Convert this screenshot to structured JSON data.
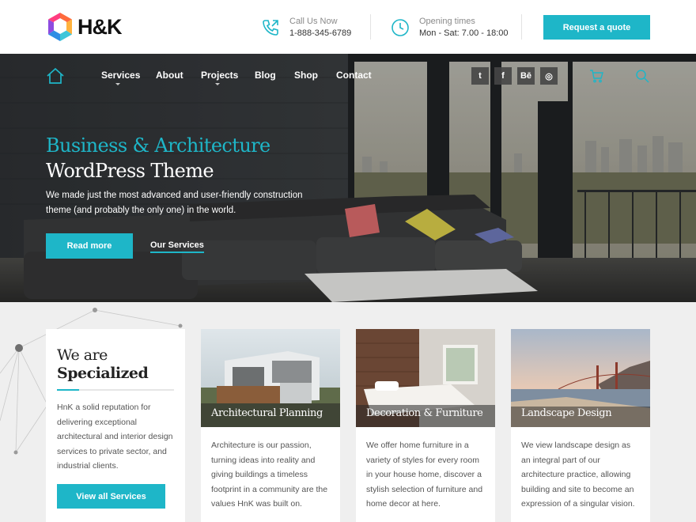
{
  "brand": {
    "logo_text": "H&K",
    "accent": "#1eb6c8"
  },
  "header": {
    "call_label": "Call Us Now",
    "call_value": "1-888-345-6789",
    "hours_label": "Opening times",
    "hours_value": "Mon - Sat: 7.00 - 18:00",
    "quote_button": "Request a quote"
  },
  "nav": {
    "items": [
      "Services",
      "About",
      "Projects",
      "Blog",
      "Shop",
      "Contact"
    ],
    "social": [
      "twitter-icon",
      "facebook-icon",
      "behance-icon",
      "dribbble-icon"
    ],
    "social_glyphs": [
      "t",
      "f",
      "Bē",
      "◎"
    ]
  },
  "hero": {
    "title_line1": "Business & Architecture",
    "title_line2": "WordPress Theme",
    "text": "We made just the most advanced and user-friendly construction theme (and probably the only one) in the world.",
    "read_more": "Read more",
    "our_services": "Our Services"
  },
  "specialized": {
    "title_line1": "We are",
    "title_line2": "Specialized",
    "text": "HnK a solid reputation for delivering exceptional architectural and interior design services to private sector, and industrial clients.",
    "button": "View all Services"
  },
  "services": [
    {
      "title": "Architectural Planning",
      "text": "Architecture is our passion, turning ideas into reality and giving buildings a timeless footprint in a community are the values HnK was built on."
    },
    {
      "title": "Decoration & Furniture",
      "text": "We offer home furniture in a variety of styles for every room in your house home, discover a stylish selection of furniture and home decor at here."
    },
    {
      "title": "Landscape Design",
      "text": "We view landscape design as an integral part of our architecture practice, allowing building and site to become an expression of a singular vision."
    }
  ]
}
